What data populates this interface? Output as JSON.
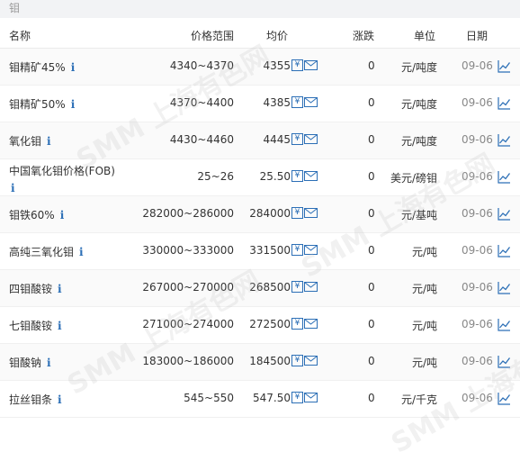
{
  "section": {
    "title": "钼"
  },
  "columns": {
    "name": "名称",
    "range": "价格范围",
    "avg": "均价",
    "change": "涨跌",
    "unit": "单位",
    "date": "日期"
  },
  "rows": [
    {
      "name": "钼精矿45%",
      "range": "4340~4370",
      "avg": "4355",
      "change": "0",
      "unit": "元/吨度",
      "date": "09-06"
    },
    {
      "name": "钼精矿50%",
      "range": "4370~4400",
      "avg": "4385",
      "change": "0",
      "unit": "元/吨度",
      "date": "09-06"
    },
    {
      "name": "氧化钼",
      "range": "4430~4460",
      "avg": "4445",
      "change": "0",
      "unit": "元/吨度",
      "date": "09-06"
    },
    {
      "name": "中国氧化钼价格(FOB)",
      "range": "25~26",
      "avg": "25.50",
      "change": "0",
      "unit": "美元/磅钼",
      "date": "09-06"
    },
    {
      "name": "钼铁60%",
      "range": "282000~286000",
      "avg": "284000",
      "change": "0",
      "unit": "元/基吨",
      "date": "09-06"
    },
    {
      "name": "高纯三氧化钼",
      "range": "330000~333000",
      "avg": "331500",
      "change": "0",
      "unit": "元/吨",
      "date": "09-06"
    },
    {
      "name": "四钼酸铵",
      "range": "267000~270000",
      "avg": "268500",
      "change": "0",
      "unit": "元/吨",
      "date": "09-06"
    },
    {
      "name": "七钼酸铵",
      "range": "271000~274000",
      "avg": "272500",
      "change": "0",
      "unit": "元/吨",
      "date": "09-06"
    },
    {
      "name": "钼酸钠",
      "range": "183000~186000",
      "avg": "184500",
      "change": "0",
      "unit": "元/吨",
      "date": "09-06"
    },
    {
      "name": "拉丝钼条",
      "range": "545~550",
      "avg": "547.50",
      "change": "0",
      "unit": "元/千克",
      "date": "09-06"
    }
  ],
  "icons": {
    "info": "info-icon",
    "yuan": "yuan-icon",
    "mail": "mail-icon",
    "chart": "trend-chart-icon",
    "info_glyph": "i",
    "yuan_glyph": "¥"
  },
  "colors": {
    "accent": "#2c6fb6",
    "header_bg": "#f2f3f5"
  },
  "watermark": "SMM 上海有色网"
}
